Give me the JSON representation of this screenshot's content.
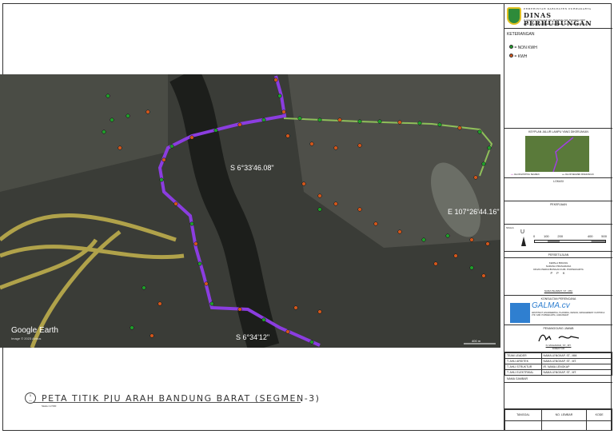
{
  "header": {
    "gov": "PEMERINTAH KABUPATEN PURWAKARTA",
    "agency": "DINAS PERHUBUNGAN",
    "address": "Jl. Veteran No.1 Ciseureuh, Kec. Purwakarta, Kab. Purwakarta 41118",
    "contact": "Email: dishub@purwakartakab.go.id  Website: dishub.purwakartakab.go.id"
  },
  "legend": {
    "title": "KETERANGAN",
    "items": [
      {
        "label": "= NON KWH",
        "color": "#1f9e2a"
      },
      {
        "label": "= KWH",
        "color": "#d2561b"
      }
    ]
  },
  "keymap": {
    "title": "KEYPLAN JALUR LAMPU YANG DIKERJAKAN",
    "legend_a": "JALUR EXISTING SEGMEN",
    "legend_b": "JALUR SEGMEN DIKERJAKAN"
  },
  "sections": {
    "lokasi": "LOKASI",
    "pekerjaan": "PEKERJAAN",
    "skala": "SKALA",
    "north": "U",
    "scale_ticks": [
      "0",
      "100",
      "200",
      "400",
      "500"
    ],
    "persetujuan": "PERSETUJUAN",
    "approver_title": "KEPALA BIDANG",
    "approver_sub": "SARANA PRASARANA",
    "approver_org": "DINAS PERHUBUNGAN KAB. PURWAKARTA",
    "approver_stamp": "P P K",
    "approver_name": "NAMA PEJABAT, ST., MM.",
    "konsultan": "KONSULTAN PERENCANA",
    "konsultan_name": "GALMA.cv",
    "konsultan_desc": "ARCHITECT, ENGINEERING, PLANNING, DESIGN, MANAGEMENT. KANTOR & JTR. KAB. PURWAKARTA, JAWA BARAT",
    "penanggung": "PENANGGUNG JAWAB",
    "pj_name": "N. MUHAMAD, ST., MT.",
    "pj_role": "DIREKTUR"
  },
  "staff": [
    [
      "TEAM LEADER",
      "NAMA LENGKAP, ST., MM."
    ],
    [
      "T. AHLI ARSITEK",
      "NAMA LENGKAP, ST., MT."
    ],
    [
      "T. AHLI STRUKTUR",
      "IR. NAMA LENGKAP"
    ],
    [
      "T. AHLI ELEKTRIKAL",
      "NAMA LENGKAP, ST., MT."
    ]
  ],
  "nama_gambar": "NAMA GAMBAR",
  "footer": {
    "cols": [
      "TANGGAL",
      "NO. LEMBAR",
      "KODE"
    ]
  },
  "map": {
    "coord1": "S 6°33'46.08\"",
    "coord2": "E 107°26'44.16\"",
    "coord3": "S 6°34'12\"",
    "brand": "Google Earth",
    "attribution": "Image © 2023 Airbus",
    "scale": "400 m"
  },
  "title": {
    "number": "1",
    "main": "PETA TITIK PJU ARAH BANDUNG BARAT (SEGMEN-3)",
    "scale": "Skala 1:2.500"
  }
}
